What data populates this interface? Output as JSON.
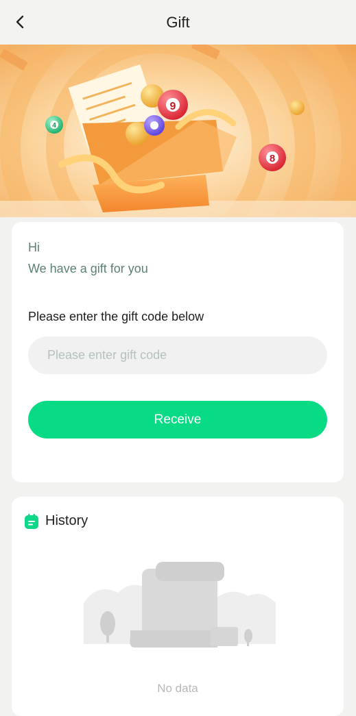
{
  "header": {
    "title": "Gift",
    "back_icon": "chevron-left-icon"
  },
  "banner": {
    "ball_numbers": [
      "9",
      "8",
      "4"
    ]
  },
  "gift_card": {
    "greeting_hi": "Hi",
    "greeting_message": "We have a gift for you",
    "prompt": "Please enter the gift code below",
    "input_placeholder": "Please enter gift code",
    "input_value": "",
    "receive_label": "Receive"
  },
  "history": {
    "title": "History",
    "icon": "calendar-icon",
    "empty_text": "No data"
  },
  "colors": {
    "accent": "#08db84",
    "greeting_text": "#5b7f76",
    "banner_orange": "#f5a24a"
  }
}
